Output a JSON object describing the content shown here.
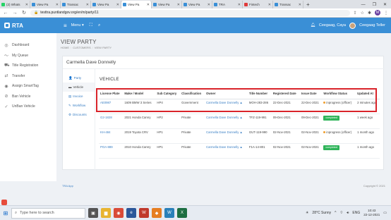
{
  "browser": {
    "tabs": [
      {
        "label": "(2) Whats",
        "color": "#25d366",
        "active": false
      },
      {
        "label": "View Pa",
        "color": "#3a8fd6",
        "active": false
      },
      {
        "label": "Transac",
        "color": "#3a8fd6",
        "active": false
      },
      {
        "label": "View Pa",
        "color": "#3a8fd6",
        "active": false
      },
      {
        "label": "View Pa",
        "color": "#3a8fd6",
        "active": true
      },
      {
        "label": "View Pa",
        "color": "#3a8fd6",
        "active": false
      },
      {
        "label": "View Pa",
        "color": "#3a8fd6",
        "active": false
      },
      {
        "label": "TRA",
        "color": "#3a8fd6",
        "active": false
      },
      {
        "label": "Fintech",
        "color": "#e03b3b",
        "active": false
      },
      {
        "label": "Transac",
        "color": "#3a8fd6",
        "active": false
      }
    ],
    "url": "testtra.puntlandgov.org/en/m/party/11",
    "profile_initial": "M"
  },
  "app": {
    "brand": "RTA",
    "menu_label": "Menu",
    "user_name": "Ceegaag, Caya",
    "user_role": "Ceegaag Teller"
  },
  "sidebar": {
    "items": [
      {
        "label": "Dashboard",
        "icon": "dashboard-icon",
        "glyph": "◎"
      },
      {
        "label": "My Queue",
        "icon": "chart-icon",
        "glyph": "〜"
      },
      {
        "label": "Title Registration",
        "icon": "car-icon",
        "glyph": "⛟"
      },
      {
        "label": "Transfer",
        "icon": "transfer-icon",
        "glyph": "⇄"
      },
      {
        "label": "Assign SmartTag",
        "icon": "tag-icon",
        "glyph": "◉"
      },
      {
        "label": "Ban Vehicle",
        "icon": "ban-icon",
        "glyph": "⊘"
      },
      {
        "label": "UnBan Vehicle",
        "icon": "check-icon",
        "glyph": "✓"
      }
    ]
  },
  "page": {
    "title": "VIEW PARTY",
    "breadcrumb": [
      "HOME",
      "CUSTOMERS",
      "VIEW PARTY"
    ]
  },
  "party": {
    "name": "Carmella Dave Donnelly",
    "tabs": [
      {
        "label": "Party",
        "icon": "person-icon",
        "glyph": "👤",
        "active": false
      },
      {
        "label": "Vehicle",
        "icon": "car-icon",
        "glyph": "▬",
        "active": true
      },
      {
        "label": "Invoice",
        "icon": "invoice-icon",
        "glyph": "▤",
        "active": false
      },
      {
        "label": "Workflow",
        "icon": "workflow-icon",
        "glyph": "✎",
        "active": false
      },
      {
        "label": "Discounts",
        "icon": "discount-icon",
        "glyph": "⚙",
        "active": false
      }
    ],
    "section_title": "VEHICLE"
  },
  "vehicles": {
    "headers": [
      "License Plate",
      "Make / Model",
      "Sub Category",
      "Classification",
      "Owner",
      "Title Number",
      "Registered Date",
      "Issue Date",
      "Workflow Status",
      "Updated At"
    ],
    "rows": [
      {
        "plate": "AE0987",
        "make": "1609 BMW 3 Series",
        "subcat": "HP4",
        "cls": "Government",
        "owner": "Carmella Dave Donnelly",
        "title": "MOH-283-286",
        "reg": "22-Dec-2021",
        "issue": "22-Dec-2021",
        "status": "inprogress (officer)",
        "status_kind": "pending",
        "updated": "2 minutes ago"
      },
      {
        "plate": "G2-1828",
        "make": "2021 Honda Camry",
        "subcat": "HP2",
        "cls": "Private",
        "owner": "Carmella Dave Donnelly",
        "title": "TFZ-119-991",
        "reg": "09-Dec-2021",
        "issue": "09-Dec-2021",
        "status": "completed",
        "status_kind": "done",
        "updated": "1 week ago"
      },
      {
        "plate": "KH-484",
        "make": "2019 Toyota CRV",
        "subcat": "HP1",
        "cls": "Private",
        "owner": "Carmella Dave Donnelly",
        "title": "GUT-119-990",
        "reg": "02-Nov-2021",
        "issue": "02-Nov-2021",
        "status": "inprogress (officer)",
        "status_kind": "pending",
        "updated": "1 month ago"
      },
      {
        "plate": "POA-889",
        "make": "2010 Honda Camry",
        "subcat": "HP1",
        "cls": "Private",
        "owner": "Carmella Dave Donnelly",
        "title": "F1A-14-801",
        "reg": "02-Nov-2021",
        "issue": "02-Nov-2021",
        "status": "completed",
        "status_kind": "done",
        "updated": "1 month ago"
      }
    ]
  },
  "footer": {
    "left": "TRA App",
    "right": "Copyright © 2021"
  },
  "taskbar": {
    "search_placeholder": "Type here to search",
    "weather": "28°C  Sunny",
    "lang": "ENG",
    "time": "10:43",
    "date": "22-12-2021"
  },
  "colors": {
    "accent": "#3a8fd6",
    "highlight": "#d9242a",
    "completed": "#2fb45a",
    "pending": "#f0a030"
  }
}
